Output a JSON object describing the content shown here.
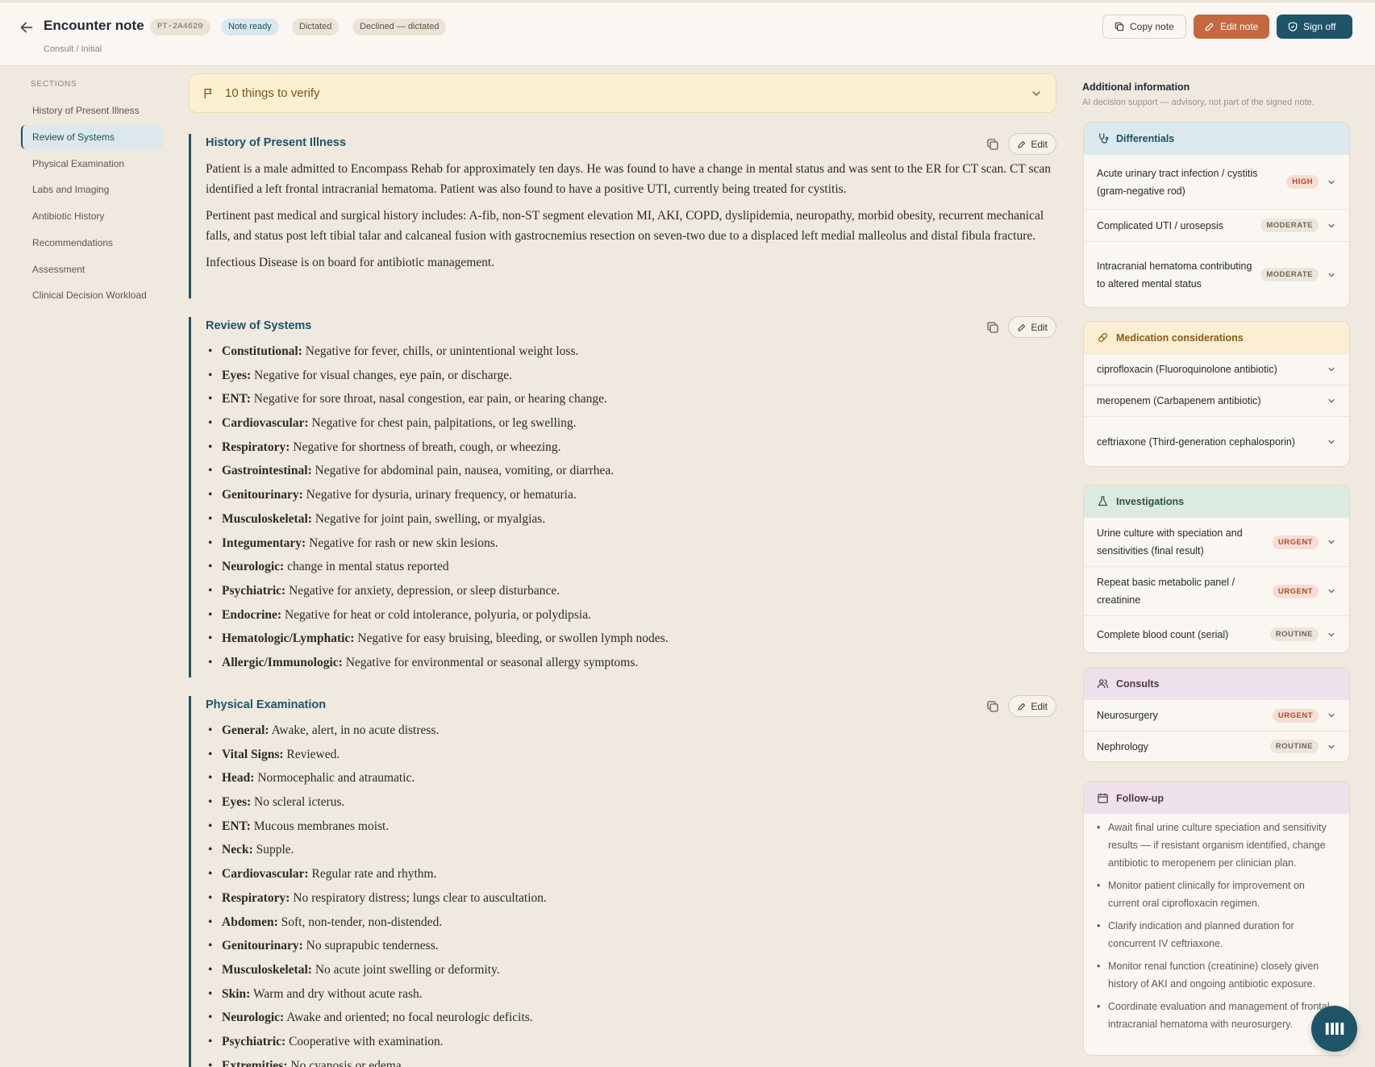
{
  "header": {
    "title": "Encounter note",
    "subtitle": "Consult / Initial",
    "patient_id": "PT-2A4620",
    "status_ready": "Note ready",
    "status_dictated": "Dictated",
    "status_declined": "Declined — dictated",
    "copy_label": "Copy note",
    "edit_label": "Edit note",
    "sign_label": "Sign off"
  },
  "sidebar": {
    "heading": "SECTIONS",
    "items": [
      {
        "label": "History of Present Illness"
      },
      {
        "label": "Review of Systems"
      },
      {
        "label": "Physical Examination"
      },
      {
        "label": "Labs and Imaging"
      },
      {
        "label": "Antibiotic History"
      },
      {
        "label": "Recommendations"
      },
      {
        "label": "Assessment"
      },
      {
        "label": "Clinical Decision Workload"
      }
    ]
  },
  "verify": {
    "label": "10 things to verify"
  },
  "note": {
    "edit_label": "Edit",
    "hpi": {
      "title": "History of Present Illness",
      "paragraphs": [
        "Patient is a male admitted to Encompass Rehab for approximately ten days. He was found to have a change in mental status and was sent to the ER for CT scan. CT scan identified a left frontal intracranial hematoma. Patient was also found to have a positive UTI, currently being treated for cystitis.",
        "Pertinent past medical and surgical history includes: A-fib, non-ST segment elevation MI, AKI, COPD, dyslipidemia, neuropathy, morbid obesity, recurrent mechanical falls, and status post left tibial talar and calcaneal fusion with gastrocnemius resection on seven-two due to a displaced left medial malleolus and distal fibula fracture.",
        "Infectious Disease is on board for antibiotic management."
      ]
    },
    "ros": {
      "title": "Review of Systems",
      "items": [
        {
          "label": "Constitutional:",
          "text": "Negative for fever, chills, or unintentional weight loss."
        },
        {
          "label": "Eyes:",
          "text": "Negative for visual changes, eye pain, or discharge."
        },
        {
          "label": "ENT:",
          "text": "Negative for sore throat, nasal congestion, ear pain, or hearing change."
        },
        {
          "label": "Cardiovascular:",
          "text": "Negative for chest pain, palpitations, or leg swelling."
        },
        {
          "label": "Respiratory:",
          "text": "Negative for shortness of breath, cough, or wheezing."
        },
        {
          "label": "Gastrointestinal:",
          "text": "Negative for abdominal pain, nausea, vomiting, or diarrhea."
        },
        {
          "label": "Genitourinary:",
          "text": "Negative for dysuria, urinary frequency, or hematuria."
        },
        {
          "label": "Musculoskeletal:",
          "text": "Negative for joint pain, swelling, or myalgias."
        },
        {
          "label": "Integumentary:",
          "text": "Negative for rash or new skin lesions."
        },
        {
          "label": "Neurologic:",
          "text": "change in mental status reported"
        },
        {
          "label": "Psychiatric:",
          "text": "Negative for anxiety, depression, or sleep disturbance."
        },
        {
          "label": "Endocrine:",
          "text": "Negative for heat or cold intolerance, polyuria, or polydipsia."
        },
        {
          "label": "Hematologic/Lymphatic:",
          "text": "Negative for easy bruising, bleeding, or swollen lymph nodes."
        },
        {
          "label": "Allergic/Immunologic:",
          "text": "Negative for environmental or seasonal allergy symptoms."
        }
      ]
    },
    "pe": {
      "title": "Physical Examination",
      "items": [
        {
          "label": "General:",
          "text": "Awake, alert, in no acute distress."
        },
        {
          "label": "Vital Signs:",
          "text": "Reviewed."
        },
        {
          "label": "Head:",
          "text": "Normocephalic and atraumatic."
        },
        {
          "label": "Eyes:",
          "text": "No scleral icterus."
        },
        {
          "label": "ENT:",
          "text": "Mucous membranes moist."
        },
        {
          "label": "Neck:",
          "text": "Supple."
        },
        {
          "label": "Cardiovascular:",
          "text": "Regular rate and rhythm."
        },
        {
          "label": "Respiratory:",
          "text": "No respiratory distress; lungs clear to auscultation."
        },
        {
          "label": "Abdomen:",
          "text": "Soft, non-tender, non-distended."
        },
        {
          "label": "Genitourinary:",
          "text": "No suprapubic tenderness."
        },
        {
          "label": "Musculoskeletal:",
          "text": "No acute joint swelling or deformity."
        },
        {
          "label": "Skin:",
          "text": "Warm and dry without acute rash."
        },
        {
          "label": "Neurologic:",
          "text": "Awake and oriented; no focal neurologic deficits."
        },
        {
          "label": "Psychiatric:",
          "text": "Cooperative with examination."
        },
        {
          "label": "Extremities:",
          "text": "No cyanosis or edema."
        }
      ]
    }
  },
  "panel": {
    "title": "Additional information",
    "subtitle": "AI decision support — advisory, not part of the signed note.",
    "differentials": {
      "title": "Differentials",
      "rows": [
        {
          "label": "Acute urinary tract infection / cystitis (gram-negative rod)",
          "badge": "HIGH"
        },
        {
          "label": "Complicated UTI / urosepsis",
          "badge": "MODERATE"
        },
        {
          "label": "Intracranial hematoma contributing to altered mental status",
          "badge": "MODERATE"
        }
      ]
    },
    "medications": {
      "title": "Medication considerations",
      "rows": [
        {
          "label": "ciprofloxacin (Fluoroquinolone antibiotic)"
        },
        {
          "label": "meropenem (Carbapenem antibiotic)"
        },
        {
          "label": "ceftriaxone (Third-generation cephalosporin)"
        }
      ]
    },
    "investigations": {
      "title": "Investigations",
      "rows": [
        {
          "label": "Urine culture with speciation and sensitivities (final result)",
          "badge": "URGENT"
        },
        {
          "label": "Repeat basic metabolic panel / creatinine",
          "badge": "URGENT"
        },
        {
          "label": "Complete blood count (serial)",
          "badge": "ROUTINE"
        }
      ]
    },
    "consults": {
      "title": "Consults",
      "rows": [
        {
          "label": "Neurosurgery",
          "badge": "URGENT"
        },
        {
          "label": "Nephrology",
          "badge": "ROUTINE"
        }
      ]
    },
    "followup": {
      "title": "Follow-up",
      "items": [
        "Await final urine culture speciation and sensitivity results — if resistant organism identified, change antibiotic to meropenem per clinician plan.",
        "Monitor patient clinically for improvement on current oral ciprofloxacin regimen.",
        "Clarify indication and planned duration for concurrent IV ceftriaxone.",
        "Monitor renal function (creatinine) closely given history of AKI and ongoing antibiotic exposure.",
        "Coordinate evaluation and management of frontal intracranial hematoma with neurosurgery."
      ]
    }
  },
  "fab": {
    "label": "IⅡI"
  }
}
